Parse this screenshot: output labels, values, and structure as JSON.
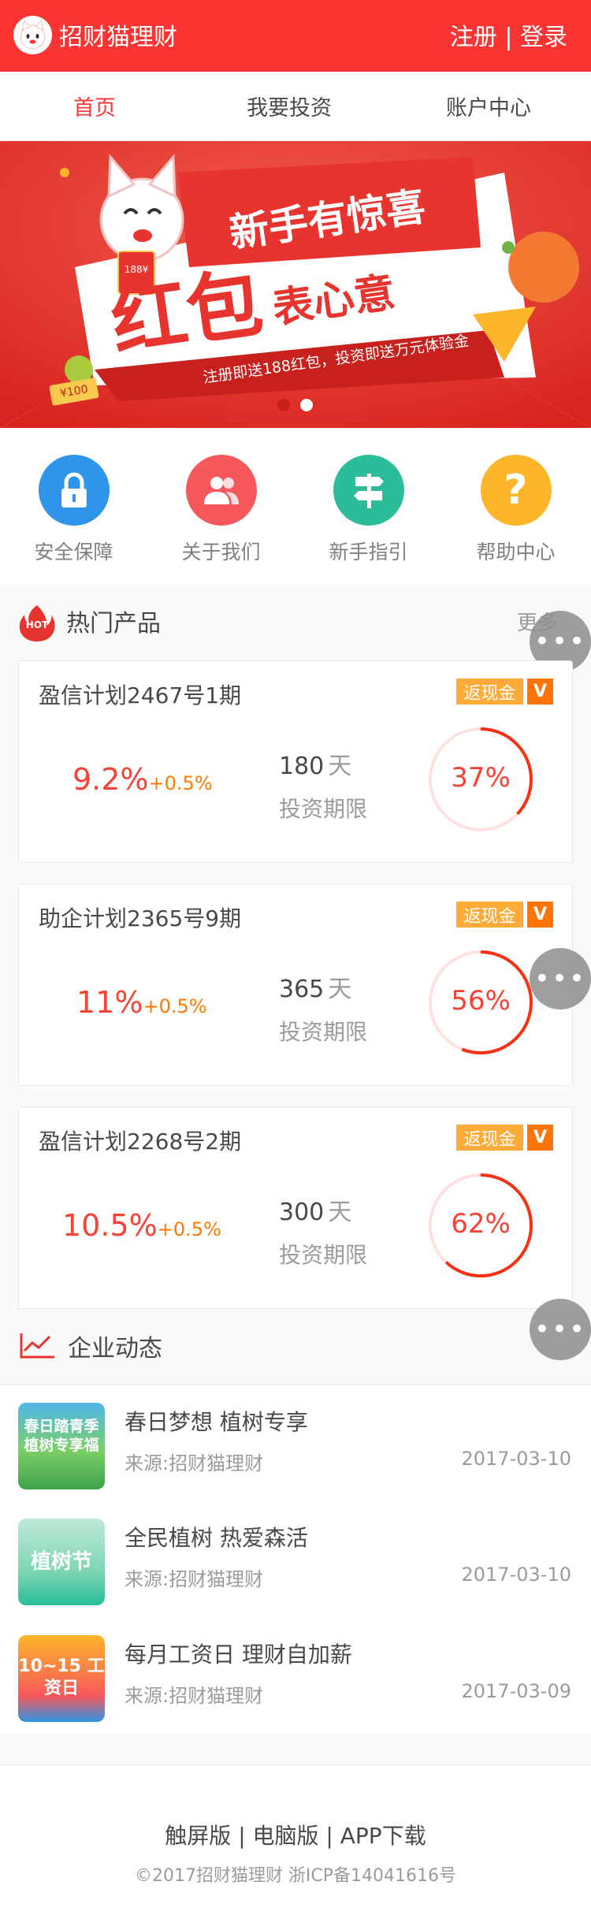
{
  "header": {
    "brand": "招财猫理财",
    "auth": "注册 | 登录"
  },
  "nav": {
    "items": [
      "首页",
      "我要投资",
      "账户中心"
    ],
    "active_color": "#ff3636"
  },
  "banner": {
    "headline": "新手有惊喜",
    "big_text": "红包",
    "sub_text": "表心意",
    "promo": "注册即送188红包，投资即送万元体验金",
    "coin_label": "¥100",
    "envelope_label": "188¥"
  },
  "quick_links": [
    {
      "label": "安全保障",
      "icon": "lock-icon",
      "color": "#2e95e8"
    },
    {
      "label": "关于我们",
      "icon": "users-icon",
      "color": "#f7585b"
    },
    {
      "label": "新手指引",
      "icon": "signpost-icon",
      "color": "#2bbd9a"
    },
    {
      "label": "帮助中心",
      "icon": "question-icon",
      "color": "#fdb529"
    }
  ],
  "hot": {
    "badge": "HOT",
    "title": "热门产品",
    "more": "更多"
  },
  "products": [
    {
      "name": "盈信计划2467号1期",
      "rate": "9.2%",
      "plus": "+0.5%",
      "days": "180",
      "unit": "天",
      "term_label": "投资期限",
      "progress_text": "37%",
      "progress": 0.37,
      "tag": "返现金",
      "tag_v": "V"
    },
    {
      "name": "助企计划2365号9期",
      "rate": "11%",
      "plus": "+0.5%",
      "days": "365",
      "unit": "天",
      "term_label": "投资期限",
      "progress_text": "56%",
      "progress": 0.56,
      "tag": "返现金",
      "tag_v": "V"
    },
    {
      "name": "盈信计划2268号2期",
      "rate": "10.5%",
      "plus": "+0.5%",
      "days": "300",
      "unit": "天",
      "term_label": "投资期限",
      "progress_text": "62%",
      "progress": 0.62,
      "tag": "返现金",
      "tag_v": "V"
    }
  ],
  "news_section": {
    "title": "企业动态"
  },
  "news": [
    {
      "title": "春日梦想 植树专享",
      "source": "来源:招财猫理财",
      "date": "2017-03-10",
      "thumb_text": "春日踏青季 植树专享福"
    },
    {
      "title": "全民植树 热爱森活",
      "source": "来源:招财猫理财",
      "date": "2017-03-10",
      "thumb_text": "植树节"
    },
    {
      "title": "每月工资日 理财自加薪",
      "source": "来源:招财猫理财",
      "date": "2017-03-09",
      "thumb_text": "10~15 工资日"
    }
  ],
  "footer": {
    "links": "触屏版 | 电脑版 | APP下载",
    "copyright": "©2017招财猫理财 浙ICP备14041616号"
  },
  "colors": {
    "brand_red": "#FA3432",
    "rate": "#FB4034",
    "plus": "#FF7900",
    "tag": "#FFAB37",
    "tag_v": "#FF7404",
    "ring": "#FA3012",
    "ring_bg": "#FFE2E0"
  }
}
